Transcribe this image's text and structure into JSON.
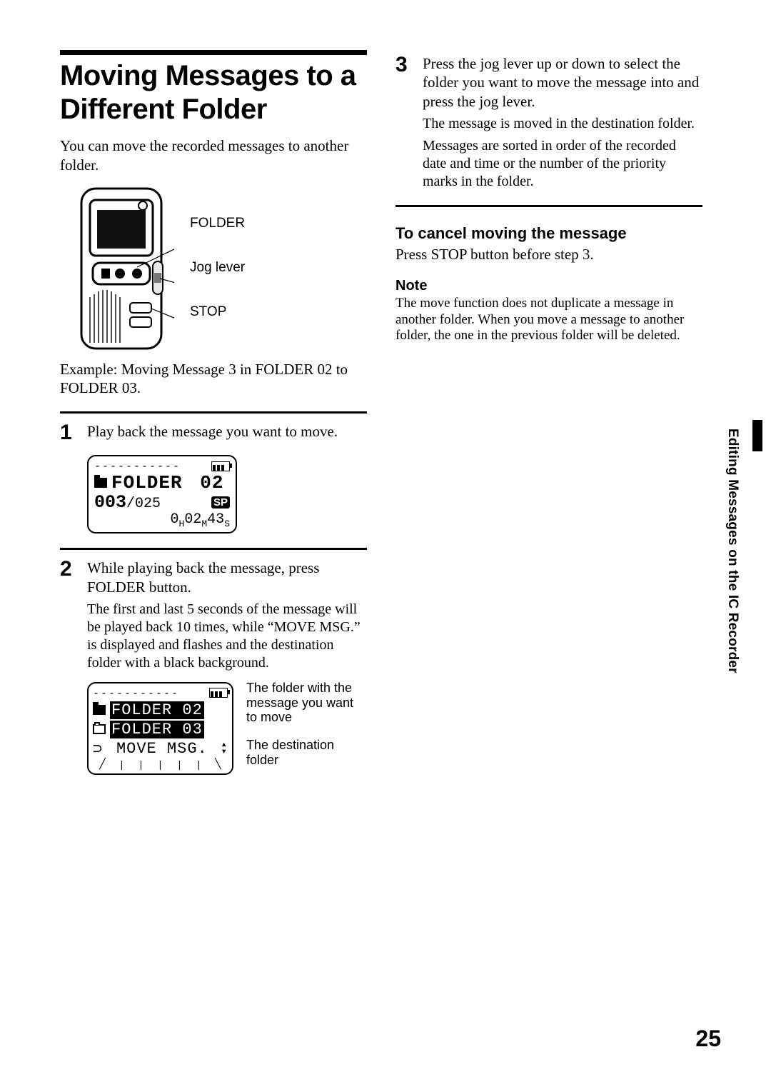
{
  "title": "Moving Messages to a Different Folder",
  "intro": "You can move the recorded messages to another folder.",
  "device_labels": {
    "folder": "FOLDER",
    "jog": "Jog lever",
    "stop": "STOP"
  },
  "example_caption": "Example: Moving Message 3 in FOLDER 02 to FOLDER 03.",
  "steps": {
    "1": {
      "num": "1",
      "text": "Play back the message you want to move."
    },
    "2": {
      "num": "2",
      "text": "While playing back the message, press FOLDER button.",
      "sub": "The first and last 5 seconds of the message will be played back 10 times, while “MOVE MSG.” is displayed and flashes and the destination folder with a black background."
    },
    "3": {
      "num": "3",
      "text": "Press the jog lever up or down to select the folder you want to move the message into and press the jog lever.",
      "sub1": "The message is moved in the destination folder.",
      "sub2": "Messages are sorted in order of the recorded date and time or the number of the priority marks in the folder."
    }
  },
  "lcd1": {
    "dashes": "-----------",
    "folder_label": "FOLDER",
    "folder_num": "02",
    "msg": "003",
    "total": "025",
    "mode": "SP",
    "time_h": "0",
    "time_m": "02",
    "time_s": "43"
  },
  "lcd2": {
    "dashes": "-----------",
    "row1": "FOLDER 02",
    "row2": "FOLDER 03",
    "move": "MOVE MSG."
  },
  "lcd2_annos": {
    "a": "The folder with the message you want to move",
    "b": "The destination folder"
  },
  "cancel": {
    "head": "To cancel moving the message",
    "body": "Press STOP button before step 3."
  },
  "note": {
    "head": "Note",
    "body": "The move function does not duplicate a message in another folder. When you move a message to another folder, the one in the previous folder will be deleted."
  },
  "side_tab": "Editing Messages on the IC Recorder",
  "page_number": "25"
}
